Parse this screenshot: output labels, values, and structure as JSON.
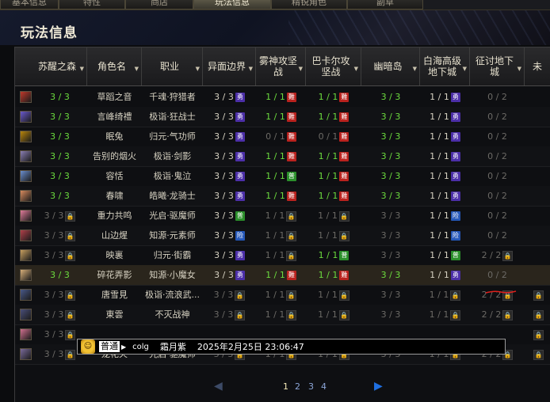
{
  "tabs": [
    {
      "label": "基本信息"
    },
    {
      "label": "特性"
    },
    {
      "label": "商店"
    },
    {
      "label": "玩法信息"
    },
    {
      "label": "精锐角色"
    },
    {
      "label": "副草"
    }
  ],
  "panel_title": "玩法信息",
  "columns": [
    {
      "label": "苏醒之森"
    },
    {
      "label": "角色名"
    },
    {
      "label": "职业"
    },
    {
      "label": "异面边界"
    },
    {
      "label": "雾神攻坚战"
    },
    {
      "label": "巴卡尔攻坚战"
    },
    {
      "label": "幽暗岛"
    },
    {
      "label": "白海高级地下城"
    },
    {
      "label": "征讨地下城"
    },
    {
      "label": "未"
    }
  ],
  "badges": {
    "hero": "勇",
    "hell": "難",
    "normal": "普",
    "adv": "险",
    "lock": "🔒"
  },
  "rows": [
    {
      "awaken": "3 / 3",
      "name": "草蹈之音",
      "job": "千魂·狩猎者",
      "border": "3 / 3",
      "fog": "1 / 1",
      "bakal": "1 / 1",
      "dark": "3 / 3",
      "white": "1 / 1",
      "raid": "0 / 2"
    },
    {
      "awaken": "3 / 3",
      "name": "言峰绮禮",
      "job": "极诣·狂战士",
      "border": "3 / 3",
      "fog": "1 / 1",
      "bakal": "1 / 1",
      "dark": "3 / 3",
      "white": "1 / 1",
      "raid": "0 / 2"
    },
    {
      "awaken": "3 / 3",
      "name": "眠兔",
      "job": "归元·气功师",
      "border": "3 / 3",
      "fog": "0 / 1",
      "bakal": "0 / 1",
      "dark": "3 / 3",
      "white": "1 / 1",
      "raid": "0 / 2"
    },
    {
      "awaken": "3 / 3",
      "name": "告别的烟火",
      "job": "极诣·剑影",
      "border": "3 / 3",
      "fog": "1 / 1",
      "bakal": "1 / 1",
      "dark": "3 / 3",
      "white": "1 / 1",
      "raid": "0 / 2"
    },
    {
      "awaken": "3 / 3",
      "name": "容恬",
      "job": "极诣·鬼泣",
      "border": "3 / 3",
      "fog": "1 / 1",
      "bakal": "1 / 1",
      "dark": "3 / 3",
      "white": "1 / 1",
      "raid": "0 / 2"
    },
    {
      "awaken": "3 / 3",
      "name": "春啸",
      "job": "皓曦·龙骑士",
      "border": "3 / 3",
      "fog": "1 / 1",
      "bakal": "1 / 1",
      "dark": "3 / 3",
      "white": "1 / 1",
      "raid": "0 / 2"
    },
    {
      "awaken": "3 / 3",
      "name": "重力共鸣",
      "job": "光启·驱魔师",
      "border": "3 / 3",
      "fog": "1 / 1",
      "bakal": "1 / 1",
      "dark": "3 / 3",
      "white": "1 / 1",
      "raid": "0 / 2"
    },
    {
      "awaken": "3 / 3",
      "name": "山边煋",
      "job": "知源·元素师",
      "border": "3 / 3",
      "fog": "1 / 1",
      "bakal": "1 / 1",
      "dark": "3 / 3",
      "white": "1 / 1",
      "raid": "0 / 2"
    },
    {
      "awaken": "3 / 3",
      "name": "映裏",
      "job": "归元·街霸",
      "border": "3 / 3",
      "fog": "1 / 1",
      "bakal": "1 / 1",
      "dark": "3 / 3",
      "white": "1 / 1",
      "raid": "2 / 2"
    },
    {
      "awaken": "3 / 3",
      "name": "碎花弄影",
      "job": "知源·小魔女",
      "border": "3 / 3",
      "fog": "1 / 1",
      "bakal": "1 / 1",
      "dark": "3 / 3",
      "white": "1 / 1",
      "raid": "0 / 2"
    },
    {
      "awaken": "3 / 3",
      "name": "唐雪見",
      "job": "极诣·流浪武...",
      "border": "3 / 3",
      "fog": "1 / 1",
      "bakal": "1 / 1",
      "dark": "3 / 3",
      "white": "1 / 1",
      "raid": "2 / 2"
    },
    {
      "awaken": "3 / 3",
      "name": "東雲",
      "job": "不灭战神",
      "border": "3 / 3",
      "fog": "1 / 1",
      "bakal": "1 / 1",
      "dark": "3 / 3",
      "white": "1 / 1",
      "raid": "2 / 2"
    },
    {
      "awaken": "3 / 3",
      "name": "",
      "job": "",
      "border": "",
      "fog": "",
      "bakal": "",
      "dark": "",
      "white": "",
      "raid": ""
    },
    {
      "awaken": "3 / 3",
      "name": "龙花火",
      "job": "光启·驱魔师",
      "border": "3 / 3",
      "fog": "1 / 1",
      "bakal": "1 / 1",
      "dark": "3 / 3",
      "white": "1 / 1",
      "raid": "2 / 2"
    }
  ],
  "tooltip": {
    "tag": "普通",
    "user": "colg",
    "name": "霜月紫",
    "time": "2025年2月25日 23:06:47"
  },
  "pager": {
    "prev": "◀",
    "next": "▶",
    "pages": [
      "1",
      "2",
      "3",
      "4"
    ]
  },
  "colors": {
    "green": "#6cdc3e",
    "hero": "#4c2fa8",
    "hell": "#b9221e",
    "normal": "#2b8f2b",
    "adv": "#2557b8"
  }
}
